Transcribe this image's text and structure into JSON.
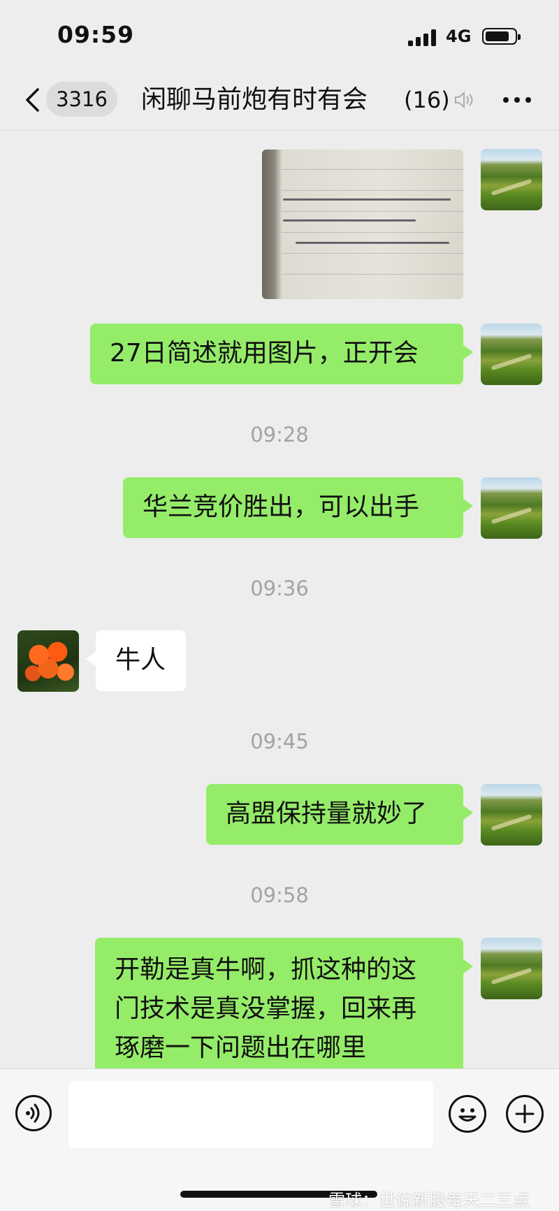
{
  "status_bar": {
    "time": "09:59",
    "network": "4G",
    "signal_icon": "signal-bars-icon",
    "battery_icon": "battery-icon"
  },
  "nav": {
    "back_icon": "chevron-left-icon",
    "unread_count": "3316",
    "title": "闲聊马前炮有时有会",
    "member_count": "(16)",
    "mute_icon": "mute-icon",
    "more_icon": "more-icon"
  },
  "messages": [
    {
      "type": "image",
      "side": "right",
      "content": "handwritten-notebook-photo"
    },
    {
      "type": "text",
      "side": "right",
      "text": "27日简述就用图片，正开会"
    },
    {
      "type": "time",
      "text": "09:28"
    },
    {
      "type": "text",
      "side": "right",
      "text": "华兰竞价胜出，可以出手"
    },
    {
      "type": "time",
      "text": "09:36"
    },
    {
      "type": "text",
      "side": "left",
      "text": "牛人"
    },
    {
      "type": "time",
      "text": "09:45"
    },
    {
      "type": "text",
      "side": "right",
      "text": "高盟保持量就妙了"
    },
    {
      "type": "time",
      "text": "09:58"
    },
    {
      "type": "text",
      "side": "right",
      "lines": [
        "开勒是真牛啊，抓这种的这",
        "门技术是真没掌握，回来再",
        "琢磨一下问题出在哪里"
      ]
    }
  ],
  "input_bar": {
    "voice_icon": "voice-icon",
    "input_value": "",
    "emoji_icon": "emoji-icon",
    "plus_icon": "plus-icon"
  },
  "watermark": "雪球：世说新股每天二三点",
  "colors": {
    "background": "#ededed",
    "my_bubble": "#95ec69",
    "their_bubble": "#ffffff",
    "timestamp": "#a3a3a3"
  }
}
